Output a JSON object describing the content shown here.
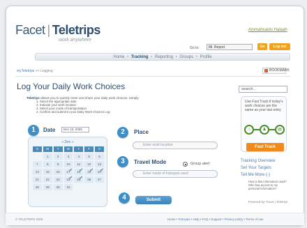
{
  "header": {
    "brand_part1": "Facet",
    "brand_sep": "|",
    "brand_part2": "Teletrips",
    "tagline": "work anywhere",
    "account_link": "Ammahsaidu Halaah",
    "goto_label": "Go to:",
    "goto_select": "Mi. Report",
    "go_button": "Go",
    "logout_button": "Log out"
  },
  "nav": {
    "items": [
      {
        "label": "Home"
      },
      {
        "label": "Tracking"
      },
      {
        "label": "Reporting"
      },
      {
        "label": "Groups"
      },
      {
        "label": "Profile"
      }
    ],
    "separator": "•"
  },
  "breadcrumb": {
    "home": "myTeletrips",
    "sep": ">>",
    "current": "Logging"
  },
  "bookmark": {
    "label": "BOOKMARK"
  },
  "page": {
    "title": "Log Your Daily Work Choices",
    "intro_brand": "Teletrips",
    "intro_text": " allows you to quickly enter and share your daily work choices. Simply:",
    "steps": [
      "1.  Select the appropriate date",
      "2.  Indicate your work location",
      "3.  Select your mode of transportation",
      "4.  Confirm and submit to your Daily Work Choices Log"
    ]
  },
  "form": {
    "step1_num": "1",
    "step1_label": "Date",
    "date_value": "Dec 10, 2008",
    "calendar_month": "« Dec »",
    "dow": [
      "S",
      "M",
      "T",
      "W",
      "T",
      "F",
      "S"
    ],
    "days": [
      "",
      "1",
      "2",
      "3",
      "4",
      "5",
      "6",
      "7",
      "8",
      "9",
      "10",
      "11",
      "12",
      "13",
      "14",
      "15",
      "16",
      "17",
      "18",
      "19",
      "20",
      "21",
      "22",
      "23",
      "24",
      "25",
      "26",
      "27",
      "28",
      "29",
      "30",
      "31",
      "",
      "",
      ""
    ],
    "step2_num": "2",
    "step2_label": "Place",
    "place_placeholder": "Enter work location",
    "step3_num": "3",
    "step3_label": "Travel Mode",
    "travel_placeholder": "Enter mode of transport used",
    "radio_label": "Group alert",
    "step4_num": "4",
    "submit_label": "Submit"
  },
  "sidebar": {
    "search_placeholder": "search...",
    "promo_text": "Use Fast Track if today's work choices are the same as your last entry.",
    "fasttrack_button": "Fast Track",
    "links": [
      "Tracking Overview",
      "Set Your Targets",
      "Tell Me More (-)"
    ],
    "note": "How is this information used? Who has access to my personal information?",
    "powered": "Powered by: Facet | Teletrips"
  },
  "footer": {
    "copyright": "© TELETRIPS 2008",
    "links": "Home • Français • Help • FAQ • Support • Privacy policy • Terms of use"
  },
  "colors": {
    "brand": "#2d4e6e",
    "accent_blue": "#3e8fc8",
    "accent_orange": "#f08a1c",
    "link_green": "#6a9a2a"
  }
}
